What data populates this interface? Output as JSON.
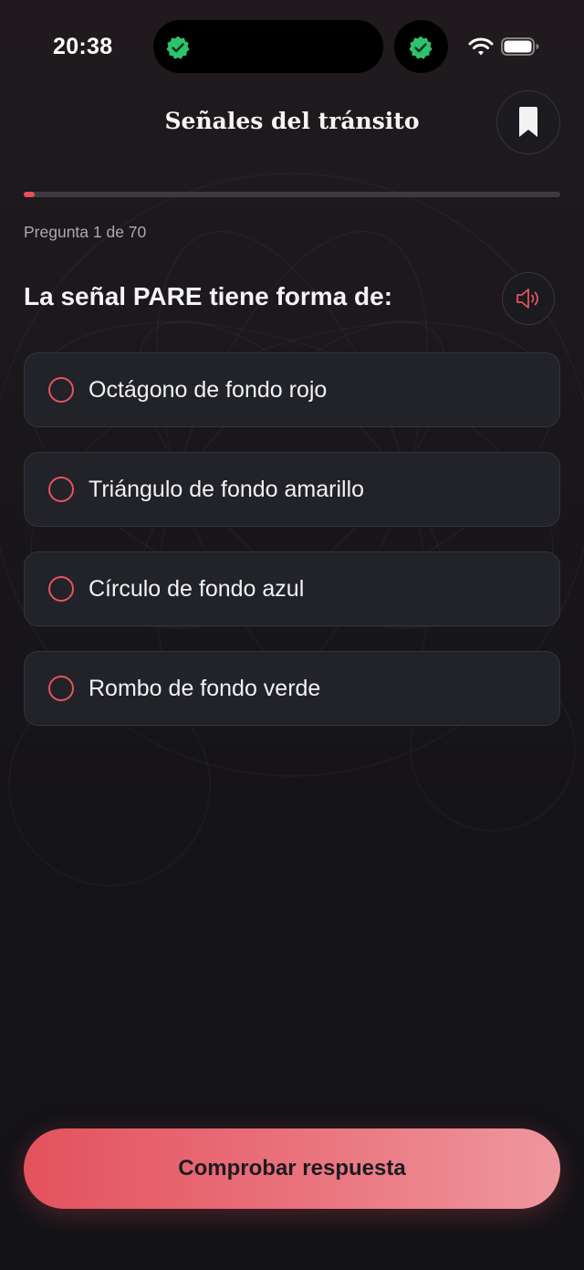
{
  "status_bar": {
    "time": "20:38",
    "icons": [
      "verified-badge-icon",
      "verified-badge-icon",
      "wifi-icon",
      "battery-icon"
    ]
  },
  "header": {
    "title": "Señales del tránsito",
    "bookmark_icon": "bookmark-icon"
  },
  "progress": {
    "label": "Pregunta 1 de 70",
    "current": 1,
    "total": 70
  },
  "question": {
    "text": "La señal PARE tiene forma de:",
    "audio_icon": "speaker-icon"
  },
  "options": [
    {
      "label": "Octágono de fondo rojo"
    },
    {
      "label": "Triángulo de fondo amarillo"
    },
    {
      "label": "Círculo de fondo azul"
    },
    {
      "label": "Rombo de fondo verde"
    }
  ],
  "submit": {
    "label": "Comprobar respuesta"
  },
  "colors": {
    "accent": "#e4505b",
    "background": "#141418",
    "card": "#212329",
    "badge_green": "#2fc26c"
  }
}
